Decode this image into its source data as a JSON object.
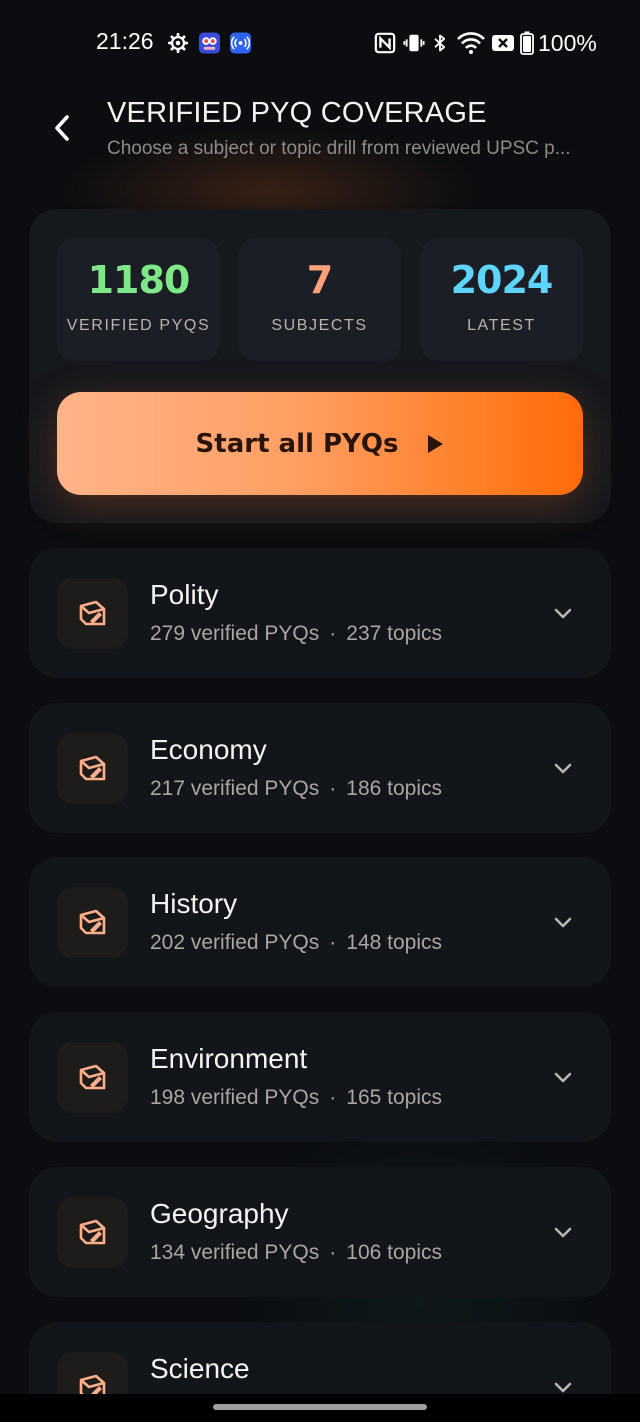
{
  "status_bar": {
    "time": "21:26",
    "battery": "100%",
    "left_icons": [
      "gear-icon",
      "app-badge-icon",
      "radio-icon"
    ],
    "right_icons": [
      "nfc-icon",
      "vibrate-icon",
      "bluetooth-icon",
      "wifi-icon",
      "sim-off-icon",
      "battery-icon"
    ]
  },
  "header": {
    "title": "VERIFIED PYQ COVERAGE",
    "subtitle": "Choose a subject or topic drill from reviewed UPSC p..."
  },
  "summary": {
    "stats": [
      {
        "value": "1180",
        "label": "VERIFIED PYQS",
        "color": "#7ee787"
      },
      {
        "value": "7",
        "label": "SUBJECTS",
        "color": "#ffa27a"
      },
      {
        "value": "2024",
        "label": "LATEST",
        "color": "#5fd4ff"
      }
    ],
    "start_label": "Start all PYQs"
  },
  "subjects": [
    {
      "name": "Polity",
      "pyqs": "279 verified PYQs",
      "topics": "237 topics"
    },
    {
      "name": "Economy",
      "pyqs": "217 verified PYQs",
      "topics": "186 topics"
    },
    {
      "name": "History",
      "pyqs": "202 verified PYQs",
      "topics": "148 topics"
    },
    {
      "name": "Environment",
      "pyqs": "198 verified PYQs",
      "topics": "165 topics"
    },
    {
      "name": "Geography",
      "pyqs": "134 verified PYQs",
      "topics": "106 topics"
    },
    {
      "name": "Science",
      "pyqs": "",
      "topics": ""
    }
  ],
  "colors": {
    "accent": "#ff7a1f",
    "icon": "#ffb08a",
    "background": "#0b0d10",
    "card": "#12151a"
  }
}
